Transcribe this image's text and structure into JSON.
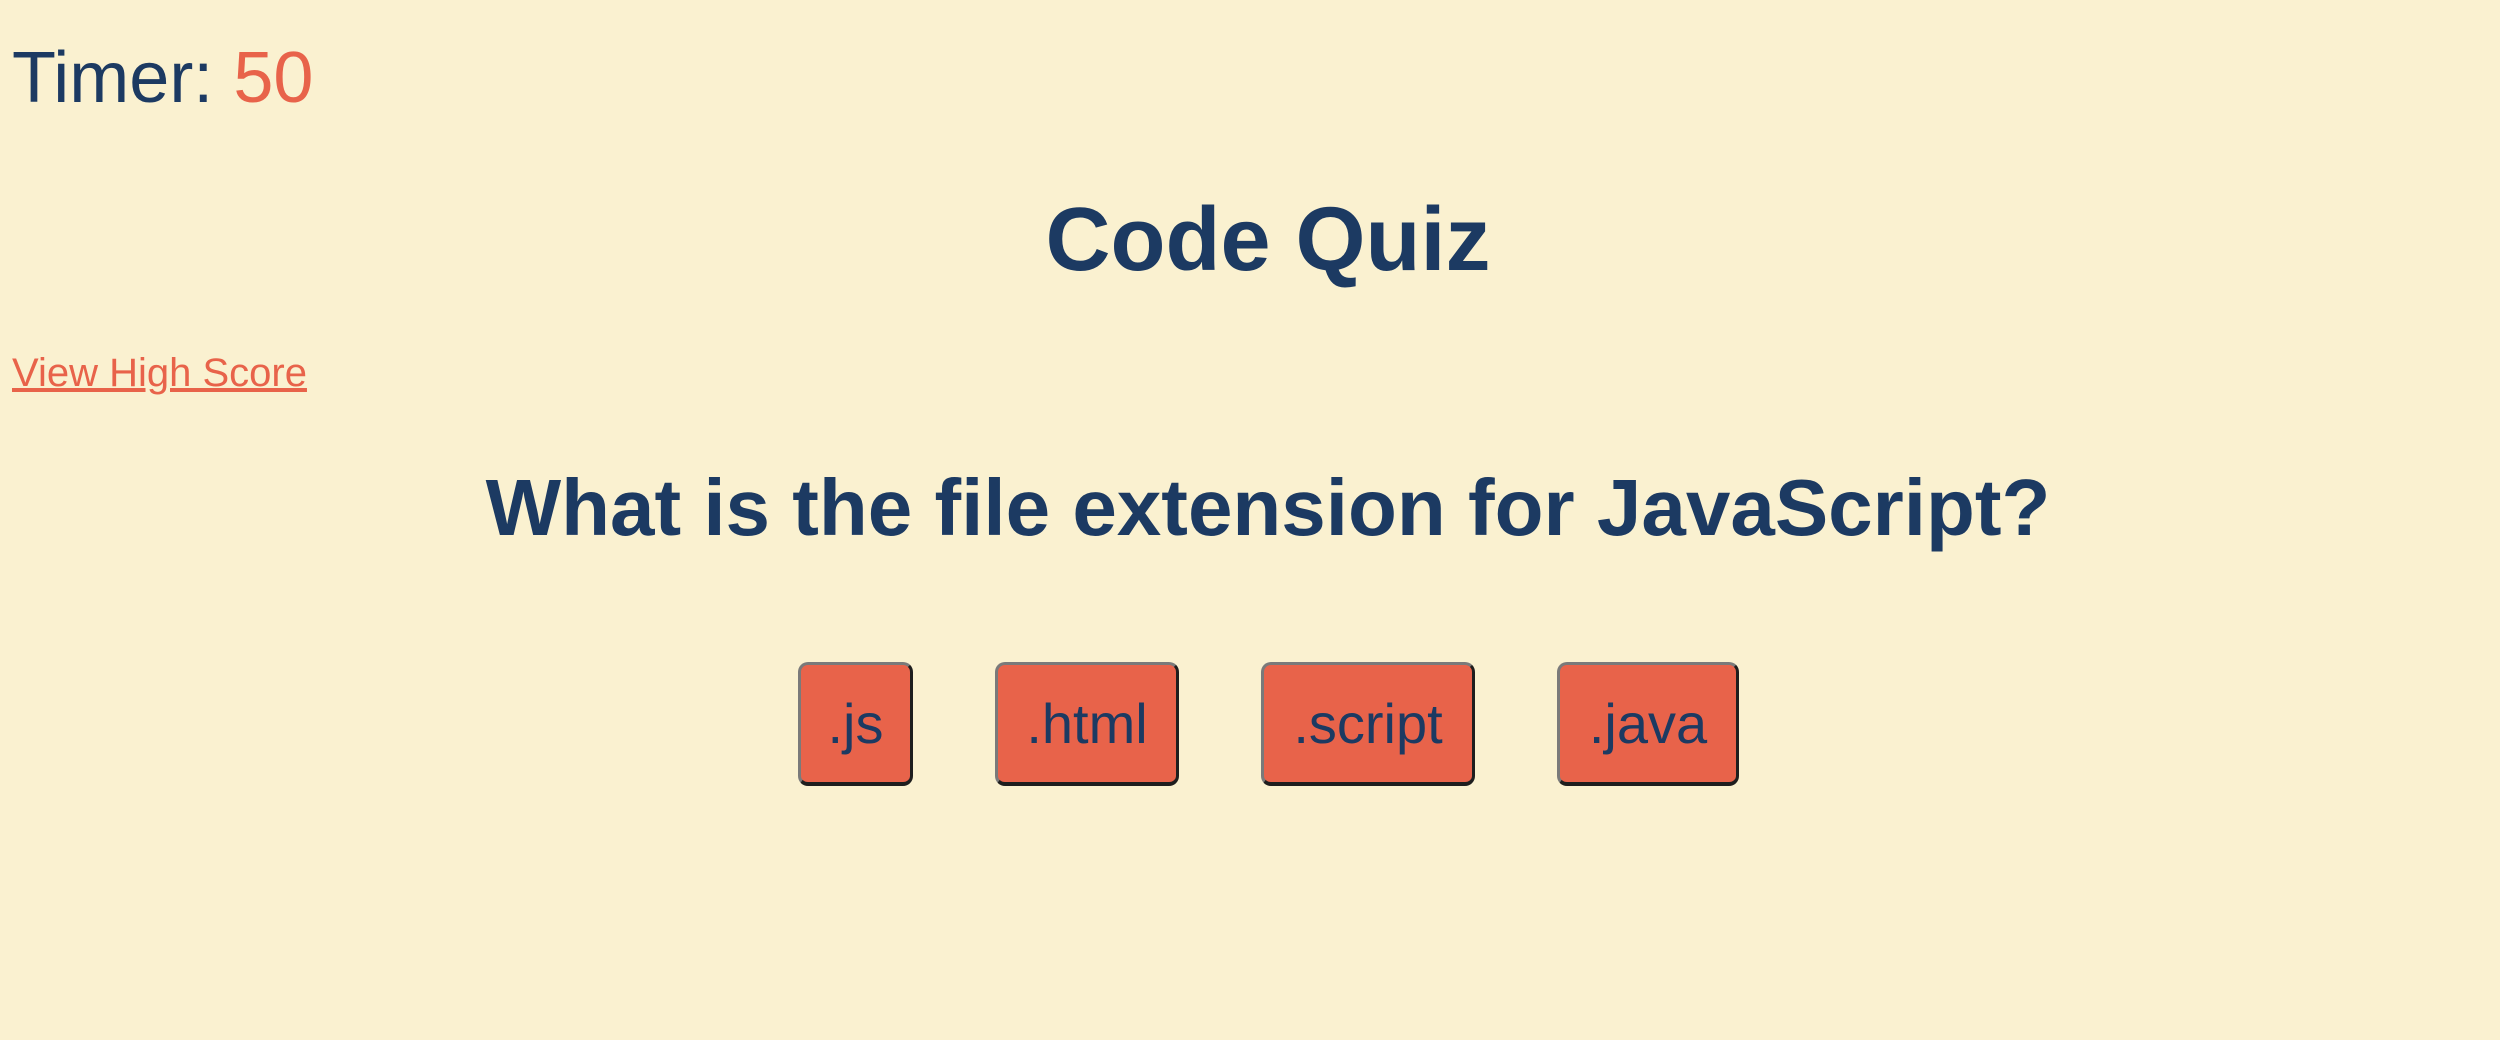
{
  "header": {
    "timer_label": "Timer:",
    "timer_value": "50",
    "title": "Code Quiz",
    "high_score_link": "View High Score"
  },
  "quiz": {
    "question": "What is the file extension for JavaScript?",
    "answers": [
      {
        "label": ".js"
      },
      {
        "label": ".html"
      },
      {
        "label": ".script"
      },
      {
        "label": ".java"
      }
    ]
  },
  "colors": {
    "background": "#faf1d0",
    "text": "#1c3a62",
    "accent": "#e8634a"
  }
}
